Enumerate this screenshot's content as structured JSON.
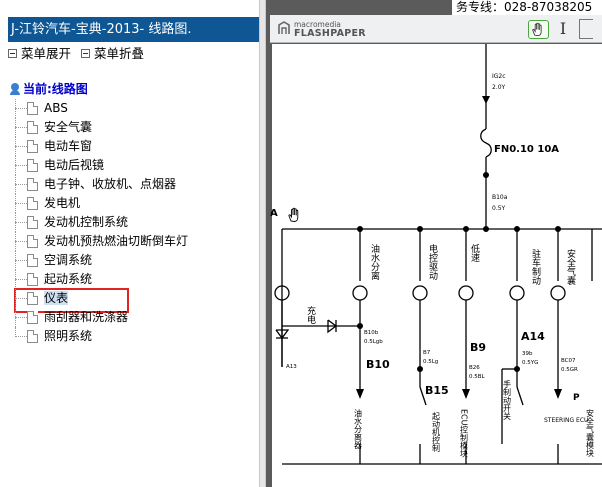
{
  "left_panel": {
    "title": "J-江铃汽车-宝典-2013- 线路图.",
    "expand_label": "菜单展开",
    "collapse_label": "菜单折叠",
    "tree_root": "当前:线路图",
    "items": [
      {
        "label": "ABS"
      },
      {
        "label": "安全气囊"
      },
      {
        "label": "电动车窗"
      },
      {
        "label": "电动后视镜"
      },
      {
        "label": "电子钟、收放机、点烟器"
      },
      {
        "label": "发电机"
      },
      {
        "label": "发动机控制系统"
      },
      {
        "label": "发动机预热燃油切断倒车灯"
      },
      {
        "label": "空调系统"
      },
      {
        "label": "起动系统"
      },
      {
        "label": "仪表",
        "selected": true
      },
      {
        "label": "雨刮器和洗涤器"
      },
      {
        "label": "照明系统"
      }
    ]
  },
  "viewer": {
    "hotline": "务专线：028-87038205",
    "logo_small": "macromedia",
    "logo_big": "FLASHPAPER",
    "text_tool": "I",
    "tools": [
      "hand-tool",
      "text-select-tool"
    ]
  },
  "schematic": {
    "texts": {
      "fuse": "FN0.10 10A",
      "wire_top1": "IG2c",
      "wire_top2": "2.0Y",
      "wire_mid1": "B10a",
      "wire_mid2": "0.5Y",
      "edge_letter": "A",
      "ind1": "充电",
      "ind2": "油水分离",
      "ind3": "电控驱动",
      "ind4": "低速",
      "ind5": "驻车制动",
      "ind6": "安全气囊",
      "w_b10a": "B10b",
      "w_b10b": "0.5Lgb",
      "w_b7a": "B7",
      "w_b7b": "0.5Lg",
      "w_b26a": "B26",
      "w_b26b": "0.5BL",
      "w_39a": "39b",
      "w_39b": "0.5YG",
      "w_cc7a": "BC07",
      "w_cc7b": "0.5GR",
      "w_d13": "A13",
      "c_b10": "B10",
      "c_b15": "B15",
      "c_b9": "B9",
      "c_a14": "A14",
      "c_p": "P",
      "lbl_oil": "油水分离器",
      "lbl_engine": "起动机控制",
      "lbl_ecu": "ECU控制模块",
      "lbl_hb": "手制动开关",
      "lbl_steer": "STEERING ECU",
      "lbl_airbag": "安全气囊模块"
    }
  },
  "colors": {
    "title_bg": "#0e5794",
    "tree_root": "#0000cc",
    "selection_box": "#e02424",
    "viewer_bg": "#5b5b5b"
  }
}
